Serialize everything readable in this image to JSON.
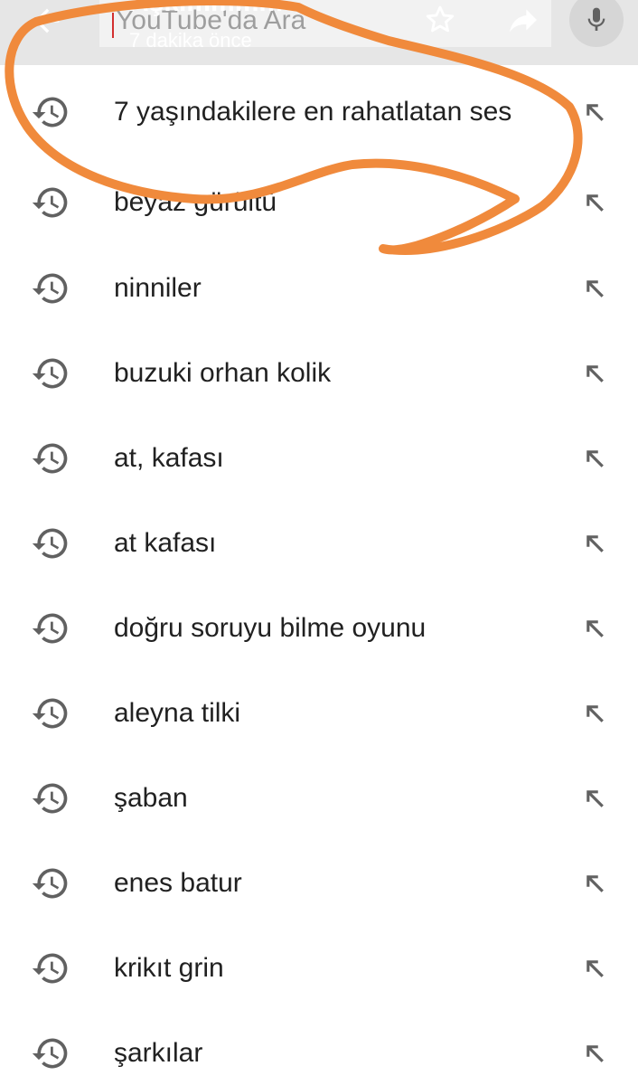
{
  "search": {
    "placeholder": "YouTube'da Ara"
  },
  "shared_overlay": {
    "name": "Aşkımmmm",
    "time": "7 dakika önce"
  },
  "icons": {
    "back": "arrow-left-icon",
    "star": "star-outline-icon",
    "forward": "share-forward-icon",
    "mic": "microphone-icon",
    "history": "history-clock-icon",
    "insert": "arrow-up-left-icon"
  },
  "colors": {
    "annotation": "#f08a3c",
    "text": "#212121",
    "icon": "#616161"
  },
  "history": [
    {
      "query": "7 yaşındakilere en rahatlatan ses"
    },
    {
      "query": "beyaz gürültü"
    },
    {
      "query": "ninniler"
    },
    {
      "query": "buzuki orhan kolik"
    },
    {
      "query": "at, kafası"
    },
    {
      "query": "at kafası"
    },
    {
      "query": "doğru soruyu bilme oyunu"
    },
    {
      "query": "aleyna tilki"
    },
    {
      "query": "şaban"
    },
    {
      "query": "enes batur"
    },
    {
      "query": "krikıt grin"
    },
    {
      "query": "şarkılar"
    }
  ]
}
